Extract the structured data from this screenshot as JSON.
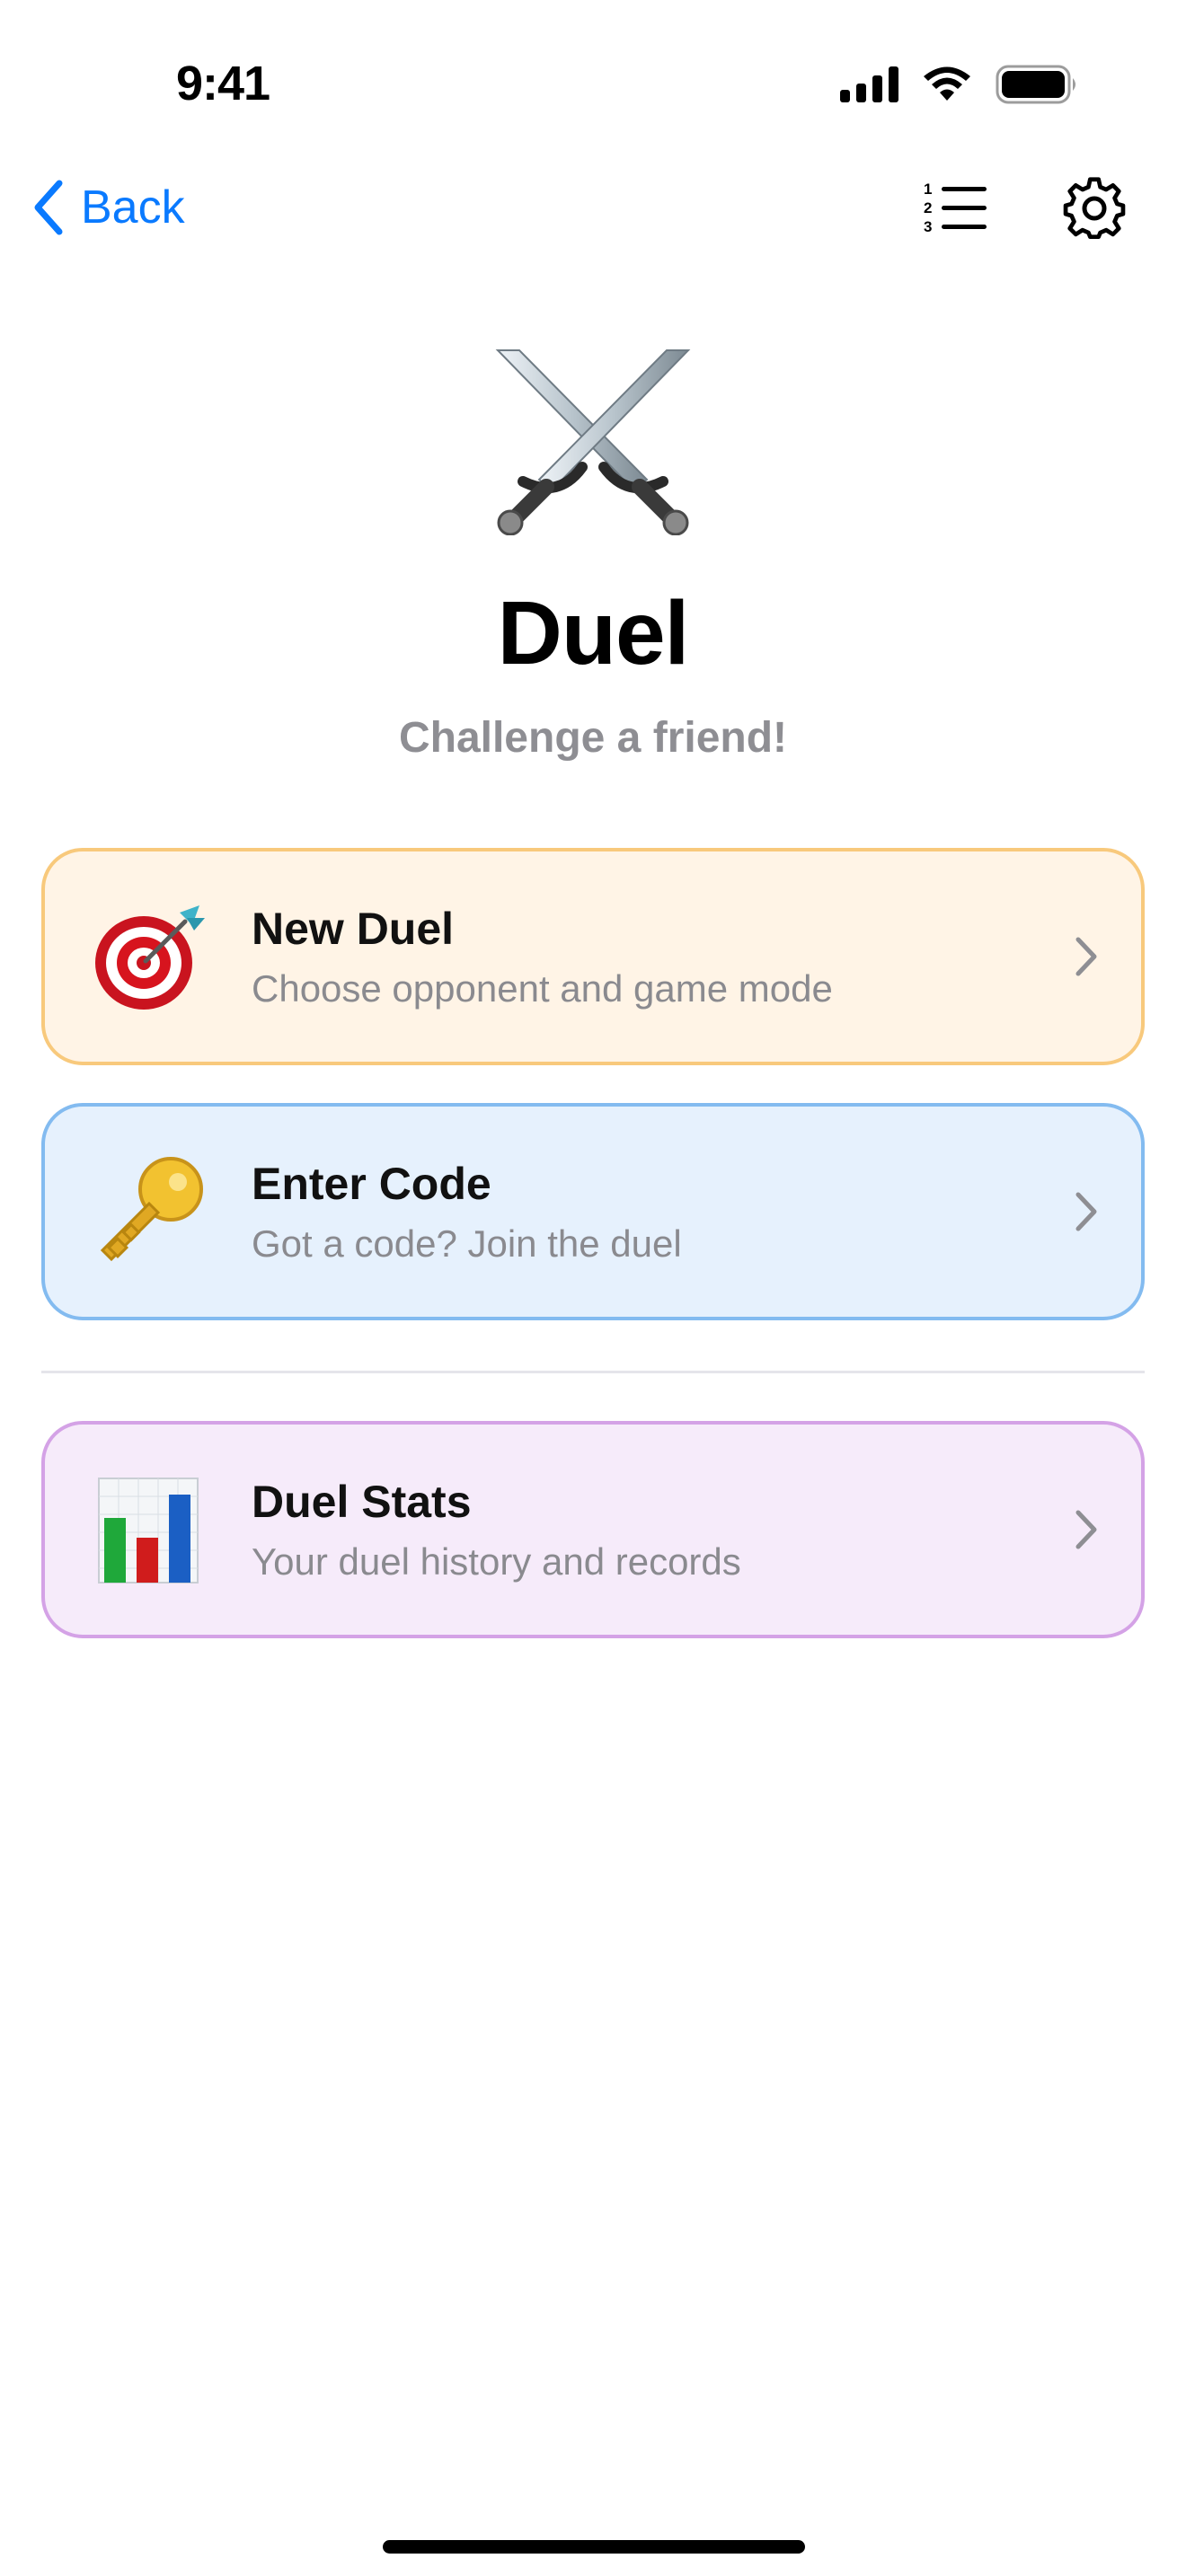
{
  "status_bar": {
    "time": "9:41",
    "icons": [
      "cellular-signal-icon",
      "wifi-icon",
      "battery-icon"
    ]
  },
  "nav": {
    "back_label": "Back",
    "icons": [
      "chevron-left-icon",
      "numbered-list-icon",
      "gear-icon"
    ]
  },
  "hero": {
    "icon": "crossed-swords-icon",
    "title": "Duel",
    "subtitle": "Challenge a friend!"
  },
  "cards": [
    {
      "icon": "target-dart-icon",
      "title": "New Duel",
      "description": "Choose opponent and game mode",
      "accent": "#f8c97c",
      "background": "#fff4e6"
    },
    {
      "icon": "key-icon",
      "title": "Enter Code",
      "description": "Got a code? Join the duel",
      "accent": "#83bbf0",
      "background": "#e6f1fd"
    },
    {
      "icon": "bar-chart-icon",
      "title": "Duel Stats",
      "description": "Your duel history and records",
      "accent": "#d4a2e6",
      "background": "#f6ebfa"
    }
  ],
  "colors": {
    "accent_blue": "#0a7aff",
    "subtitle_gray": "#8e8e93"
  }
}
